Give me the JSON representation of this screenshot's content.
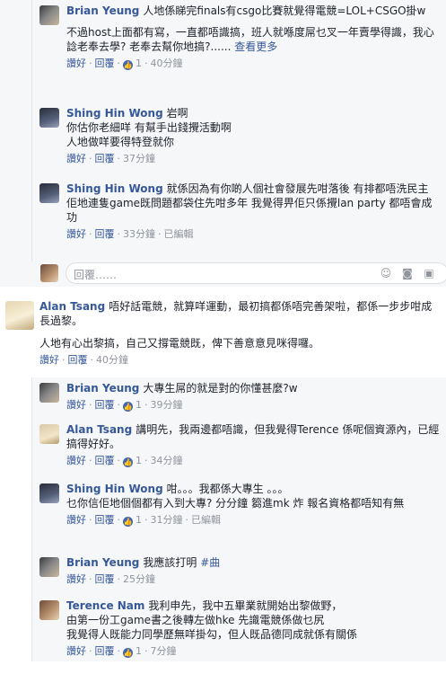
{
  "top_thread": {
    "replies": [
      {
        "name": "Brian Yeung",
        "text1": "人地係睇完finals有csgo比賽就覺得電競=LOL+CSGO掛w",
        "text2": "不過host上面都有寫，一直都唔識搞，班人就喺度屌乜叉一年賣學得識，我心諗老奉去學? 老奉去幫你地搞?......",
        "see_more": "查看更多",
        "like": "讚好",
        "reply": "回覆",
        "likes": "1",
        "time": "40分鐘"
      },
      {
        "name": "Shing Hin Wong",
        "text1": "岩啊",
        "text2": "你估你老細咩 有幫手出錢攪活動啊",
        "text3": "人地做咩要得特登就你",
        "like": "讚好",
        "reply": "回覆",
        "time": "37分鐘"
      },
      {
        "name": "Shing Hin Wong",
        "text1": "就係因為有你啲人個社會發展先咁落後 有排都唔洗民主",
        "text2": "佢地連隻game既問題都袋住先咁多年 我覺得畀佢只係攪lan party 都唔會成功",
        "like": "讚好",
        "reply": "回覆",
        "time": "33分鐘",
        "edited": "已編輯"
      }
    ],
    "reply_placeholder": "回覆……"
  },
  "main_comment": {
    "name": "Alan Tsang",
    "text1": "唔好話電競，就算咩運動，最初搞都係唔完善架啦，都係一步步咁成長過黎。",
    "text2": "人地有心出黎搞，自己又撐電競既，俾下善意意見咪得囉。",
    "like": "讚好",
    "reply": "回覆",
    "time": "40分鐘"
  },
  "sub_replies": [
    {
      "name": "Brian Yeung",
      "text1": "大專生屌的就是對的你懂甚麼?w",
      "like": "讚好",
      "reply": "回覆",
      "likes": "1",
      "time": "39分鐘"
    },
    {
      "name": "Alan Tsang",
      "text1": "講明先，我兩邊都唔識，但我覺得Terence 係呢個資源內，已經搞得好好。",
      "like": "讚好",
      "reply": "回覆",
      "likes": "1",
      "time": "34分鐘"
    },
    {
      "name": "Shing Hin Wong",
      "text1": "咁。。。我都係大專生 。。。",
      "text2": "乜你信佢地個個都有入到大專? 分分鐘 篘進mk 炸 報名資格都唔知有無",
      "like": "讚好",
      "reply": "回覆",
      "likes": "1",
      "time": "31分鐘",
      "edited": "已編輯"
    },
    {
      "name": "Brian Yeung",
      "text1": "我應該打明",
      "hashtag": "#曲",
      "like": "讚好",
      "reply": "回覆",
      "time": "25分鐘"
    },
    {
      "name": "Terence Nam",
      "text1": "我利申先，我中五畢業就開始出黎做野，",
      "text2": "由第一份工game書之後轉左做hke 先識電競係做乜尻",
      "text3": "我覺得人既能力同學歷無咩掛勾，但人既品德同成就係有關係",
      "like": "讚好",
      "reply": "回覆",
      "likes": "1",
      "time": "7分鐘"
    }
  ],
  "colors": {
    "link": "#365899",
    "meta": "#90949c",
    "bg_thread": "#f6f7f9"
  }
}
